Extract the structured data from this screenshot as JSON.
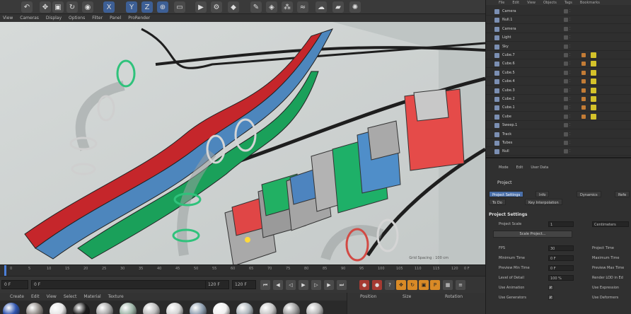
{
  "colors": {
    "accent": "#4a6fa8",
    "playhead": "#4c7fd8",
    "record": "#a53a32",
    "tag": "#d4c22a"
  },
  "toolbar": {
    "icons": [
      "undo-icon",
      "move-icon",
      "scale-icon",
      "rotate-icon",
      "live-select-icon",
      "x-axis-icon",
      "y-axis-icon",
      "z-axis-icon",
      "coordinate-icon",
      "render-view-icon",
      "render-icon",
      "render-settings-icon",
      "cube-icon",
      "pen-icon",
      "subdivide-icon",
      "array-icon",
      "deformer-icon",
      "scene-icon",
      "camera-icon",
      "light-icon"
    ]
  },
  "viewport_menu": [
    "View",
    "Cameras",
    "Display",
    "Options",
    "Filter",
    "Panel",
    "ProRender"
  ],
  "viewport": {
    "grid_label": "Grid Spacing : 100 cm"
  },
  "timeline": {
    "ticks": [
      "0",
      "5",
      "10",
      "15",
      "20",
      "25",
      "30",
      "35",
      "40",
      "45",
      "50",
      "55",
      "60",
      "65",
      "70",
      "75",
      "80",
      "85",
      "90",
      "95",
      "100",
      "105",
      "110",
      "115",
      "120"
    ],
    "end_label": "0 F"
  },
  "transport": {
    "start_field": "0 F",
    "current_field": "0 F",
    "end_field": "120 F",
    "max_field": "120 F"
  },
  "materials_menu": [
    "Create",
    "Edit",
    "View",
    "Select",
    "Material",
    "Texture"
  ],
  "materials": [
    "#2f55b0",
    "#8f8a86",
    "#e7e7e7",
    "#1c1c1c",
    "#a6a6a6",
    "#9eb5a8",
    "#bcbcbc",
    "#d4d4d4",
    "#8f9fb0",
    "#f0f0f0",
    "#aeb6bc",
    "#c6c6c6",
    "#9c9c9c",
    "#b7b7b7"
  ],
  "coordinates_head": {
    "position": "Position",
    "size": "Size",
    "rotation": "Rotation"
  },
  "objects_menu": [
    "File",
    "Edit",
    "View",
    "Objects",
    "Tags",
    "Bookmarks"
  ],
  "objects": [
    {
      "name": "Camera",
      "tag": false
    },
    {
      "name": "Null.1",
      "tag": false
    },
    {
      "name": "Camera",
      "tag": false
    },
    {
      "name": "Light",
      "tag": false
    },
    {
      "name": "Sky",
      "tag": false
    },
    {
      "name": "Cube.7",
      "tag": true
    },
    {
      "name": "Cube.6",
      "tag": true
    },
    {
      "name": "Cube.5",
      "tag": true
    },
    {
      "name": "Cube.4",
      "tag": true
    },
    {
      "name": "Cube.3",
      "tag": true
    },
    {
      "name": "Cube.2",
      "tag": true
    },
    {
      "name": "Cube.1",
      "tag": true
    },
    {
      "name": "Cube",
      "tag": true
    },
    {
      "name": "Sweep.1",
      "tag": false
    },
    {
      "name": "Track",
      "tag": false
    },
    {
      "name": "Tubes",
      "tag": false
    },
    {
      "name": "Null",
      "tag": false
    }
  ],
  "attributes": {
    "menu": [
      "Mode",
      "Edit",
      "User Data"
    ],
    "title": "Project",
    "tabs": [
      "Project Settings",
      "Info",
      "Dynamics",
      "Refe"
    ],
    "tabs2": [
      "To Do",
      "Key Interpolation"
    ],
    "section": "Project Settings",
    "project_scale_label": "Project Scale",
    "project_scale_value": "1",
    "project_scale_unit": "Centimeters",
    "scale_button": "Scale Project...",
    "rows": [
      {
        "label": "FPS",
        "value": "30",
        "label2": "Project Time"
      },
      {
        "label": "Minimum Time",
        "value": "0 F",
        "label2": "Maximum Time"
      },
      {
        "label": "Preview Min Time",
        "value": "0 F",
        "label2": "Preview Max Time"
      },
      {
        "label": "Level of Detail",
        "value": "100 %",
        "label2": "Render LOD in Ed"
      },
      {
        "label": "Use Animation",
        "check": true,
        "label2": "Use Expression"
      },
      {
        "label": "Use Generators",
        "check": true,
        "label2": "Use Deformers"
      }
    ]
  }
}
